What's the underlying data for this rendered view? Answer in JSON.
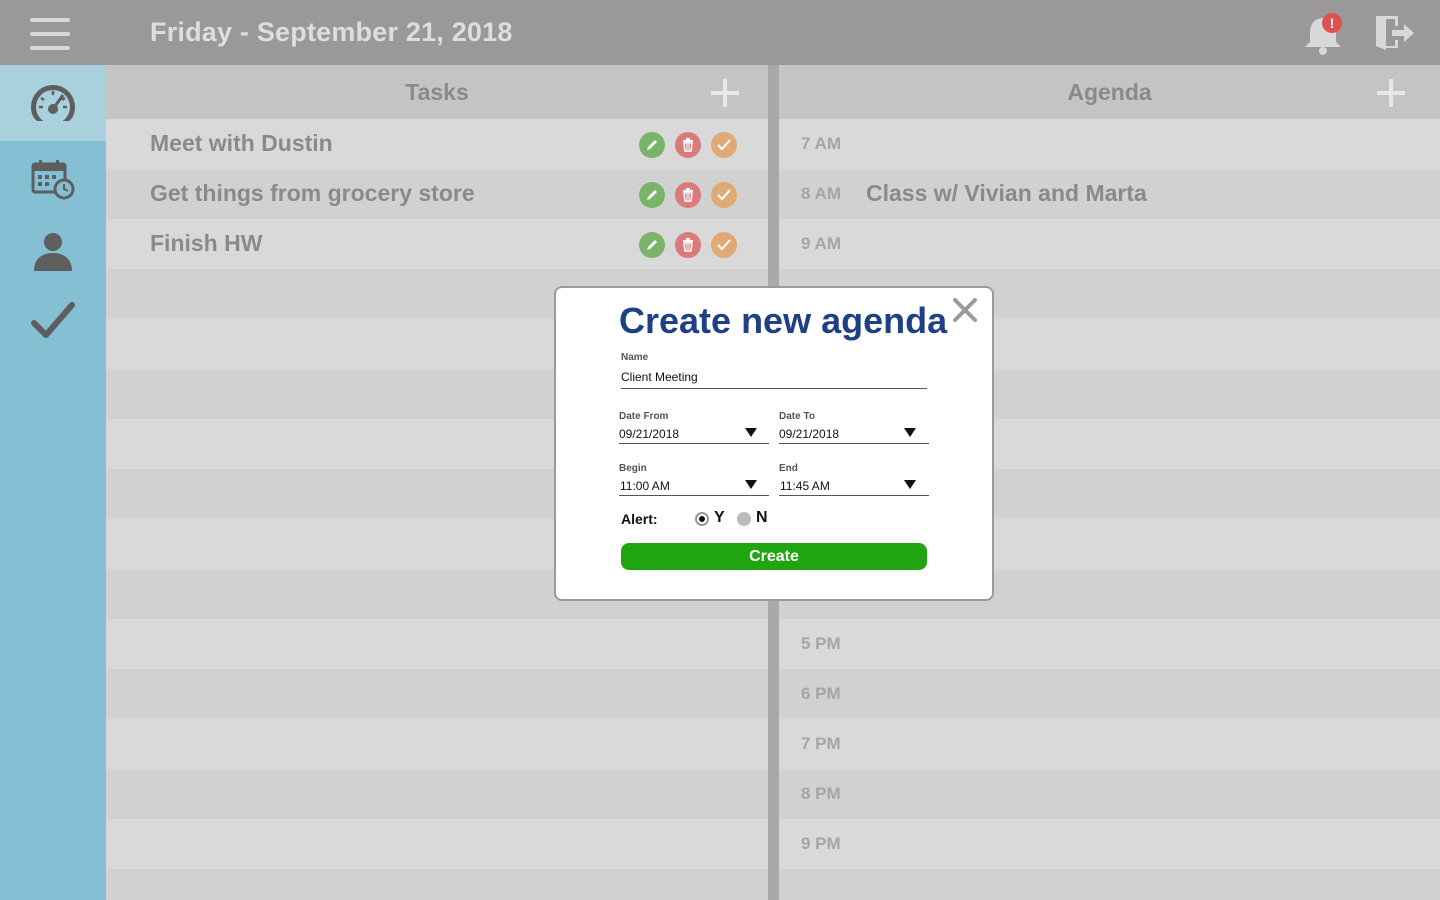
{
  "header": {
    "date": "Friday - September 21, 2018",
    "notification_badge": "!"
  },
  "sidebar": {
    "items": [
      {
        "name": "dashboard",
        "icon": "speedometer-icon",
        "active": true
      },
      {
        "name": "calendar",
        "icon": "calendar-clock-icon",
        "active": false
      },
      {
        "name": "profile",
        "icon": "user-icon",
        "active": false
      },
      {
        "name": "completed",
        "icon": "checkmark-icon",
        "active": false
      }
    ]
  },
  "tasks": {
    "title": "Tasks",
    "items": [
      {
        "label": "Meet with Dustin"
      },
      {
        "label": "Get things from grocery store"
      },
      {
        "label": "Finish HW"
      }
    ]
  },
  "agenda": {
    "title": "Agenda",
    "slots": [
      {
        "time": "7 AM",
        "event": ""
      },
      {
        "time": "8 AM",
        "event": "Class w/ Vivian and Marta"
      },
      {
        "time": "9 AM",
        "event": ""
      },
      {
        "time": "",
        "event": ""
      },
      {
        "time": "",
        "event": ""
      },
      {
        "time": "",
        "event": ""
      },
      {
        "time": "",
        "event": ""
      },
      {
        "time": "",
        "event": ""
      },
      {
        "time": "",
        "event": ""
      },
      {
        "time": "",
        "event": ""
      },
      {
        "time": "5 PM",
        "event": ""
      },
      {
        "time": "6 PM",
        "event": ""
      },
      {
        "time": "7 PM",
        "event": ""
      },
      {
        "time": "8 PM",
        "event": ""
      },
      {
        "time": "9 PM",
        "event": ""
      },
      {
        "time": "",
        "event": ""
      }
    ]
  },
  "modal": {
    "title": "Create new agenda",
    "name_label": "Name",
    "name_value": "Client Meeting",
    "date_from_label": "Date From",
    "date_from_value": "09/21/2018",
    "date_to_label": "Date To",
    "date_to_value": "09/21/2018",
    "begin_label": "Begin",
    "begin_value": "11:00 AM",
    "end_label": "End",
    "end_value": "11:45 AM",
    "alert_label": "Alert:",
    "alert_yes": "Y",
    "alert_no": "N",
    "alert_selected": "Y",
    "create_label": "Create"
  },
  "colors": {
    "topbar": "#9a9898",
    "sidebar": "#84bfd3",
    "modal_title": "#1f3f86",
    "create_button": "#1ea510",
    "edit": "#79b46a",
    "delete": "#d97b7b",
    "complete": "#dfaa76"
  }
}
